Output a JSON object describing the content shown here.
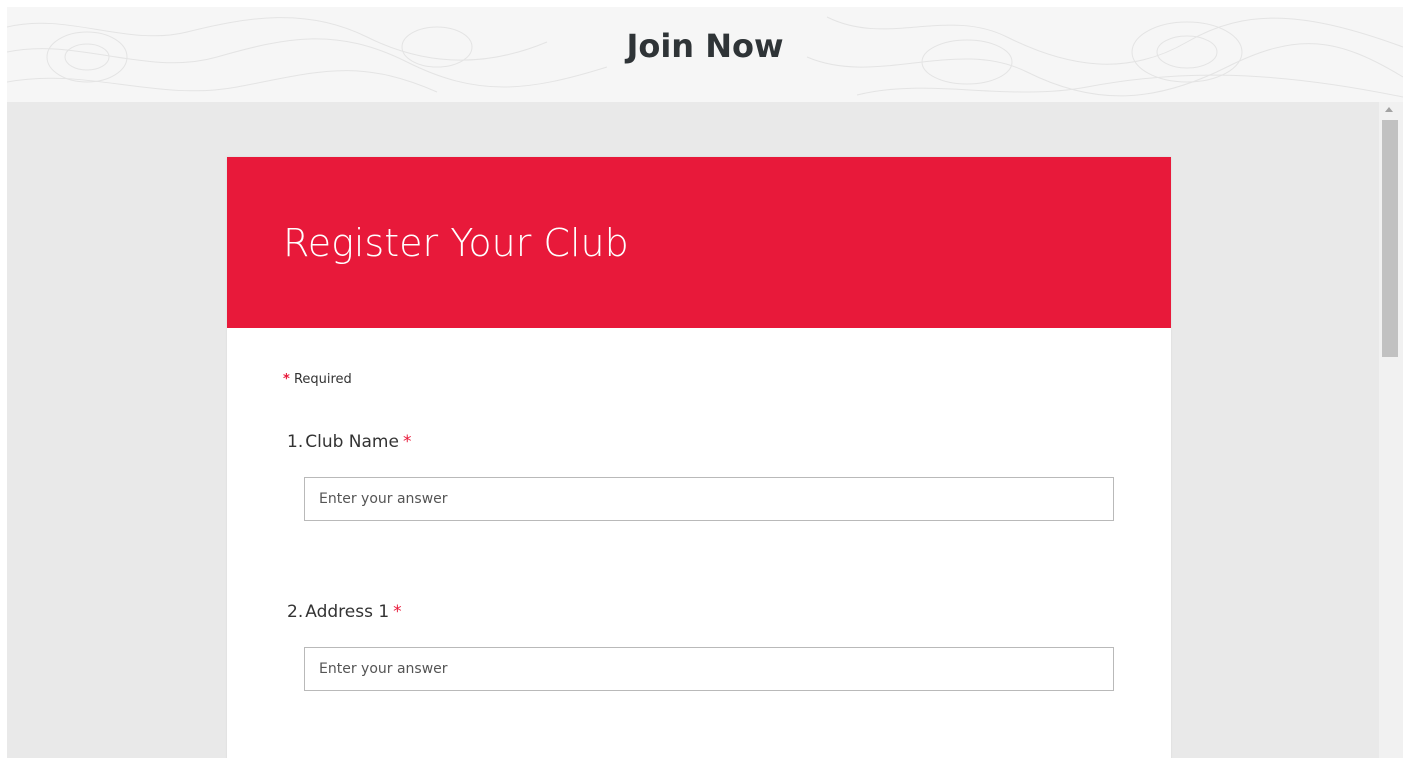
{
  "header": {
    "title": "Join Now"
  },
  "form": {
    "title": "Register Your Club",
    "required_marker": "*",
    "required_text": "Required",
    "accent_color": "#e8193a",
    "questions": [
      {
        "number": "1.",
        "label": "Club Name",
        "required_marker": "*",
        "placeholder": "Enter your answer",
        "value": ""
      },
      {
        "number": "2.",
        "label": "Address 1",
        "required_marker": "*",
        "placeholder": "Enter your answer",
        "value": ""
      }
    ]
  },
  "scrollbar": {
    "up_icon": "scroll-up-arrow-icon"
  }
}
